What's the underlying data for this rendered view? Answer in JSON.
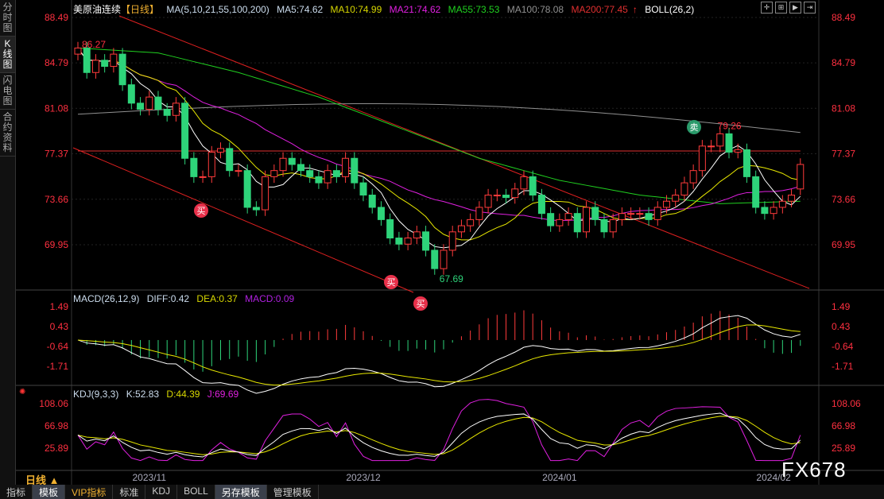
{
  "sidebar": [
    "分时图",
    "K线图",
    "闪电图",
    "合约资料"
  ],
  "header": {
    "title": "美原油连续",
    "period": "【日线】",
    "ma_label": "MA(5,10,21,55,100,200)",
    "ma5": "MA5:74.62",
    "ma10": "MA10:74.99",
    "ma21": "MA21:74.62",
    "ma55": "MA55:73.53",
    "ma100": "MA100:78.08",
    "ma200": "MA200:77.45",
    "boll": "BOLL(26,2)"
  },
  "colors": {
    "ma5": "#ffffff",
    "ma10": "#e8e800",
    "ma21": "#e020e0",
    "ma55": "#20d020",
    "ma100": "#909090",
    "ma200": "#e03030",
    "up": "#ff3b3b",
    "down": "#2ed47a",
    "axis": "#ff3040"
  },
  "macd": {
    "label": "MACD(26,12,9)",
    "diff": "DIFF:0.42",
    "dea": "DEA:0.37",
    "macd": "MACD:0.09",
    "ticks": [
      "1.49",
      "0.43",
      "-0.64",
      "-1.71"
    ]
  },
  "kdj": {
    "label": "KDJ(9,3,3)",
    "k": "K:52.83",
    "d": "D:44.39",
    "j": "J:69.69",
    "ticks": [
      "108.06",
      "66.98",
      "25.89"
    ]
  },
  "bottom_tabs": [
    "指标",
    "模板",
    "VIP指标",
    "标准",
    "KDJ",
    "BOLL",
    "另存模板",
    "管理模板"
  ],
  "period_button": "日线 ▲",
  "watermark": "FX678",
  "chart_data": {
    "type": "candlestick",
    "price_ticks": [
      "88.49",
      "84.79",
      "81.08",
      "77.37",
      "73.66",
      "69.95"
    ],
    "ylim": [
      67.5,
      88.49
    ],
    "x_labels": [
      {
        "label": "2023/11",
        "index": 8
      },
      {
        "label": "2023/12",
        "index": 32
      },
      {
        "label": "2024/01",
        "index": 54
      },
      {
        "label": "2024/02",
        "index": 78
      }
    ],
    "annotations": {
      "high": "86.27",
      "low": "67.69",
      "recent_high": "79.26",
      "buy": "买",
      "sell": "卖"
    },
    "close": [
      86,
      84,
      85,
      84.5,
      85.5,
      83,
      81.5,
      81,
      82,
      81,
      80.5,
      81.5,
      77,
      75.5,
      75.5,
      77.5,
      77.8,
      76,
      76,
      73,
      72.8,
      75.5,
      76,
      77,
      76.5,
      76,
      75.5,
      75,
      76,
      75.5,
      77,
      75,
      74,
      73,
      72,
      70.5,
      70,
      70.5,
      71,
      69.5,
      68,
      69.5,
      71,
      71.5,
      72,
      73,
      74,
      74,
      73.8,
      74.5,
      75.5,
      74,
      72.5,
      71.5,
      72,
      72.5,
      71,
      73,
      72,
      71,
      72,
      72.5,
      72.5,
      72.5,
      72,
      73,
      73.5,
      74,
      75,
      76,
      78,
      78,
      79,
      77.5,
      77.7,
      75.5,
      73,
      72.5,
      73,
      73.5,
      74,
      76.5
    ],
    "open": [
      85.5,
      86,
      84,
      85,
      84.5,
      85.5,
      83,
      81.5,
      81,
      82,
      81,
      80.5,
      81.5,
      77,
      75.5,
      75.5,
      77.5,
      77.8,
      76,
      76,
      73,
      72.8,
      75.5,
      76,
      77,
      76.5,
      76,
      75.5,
      75,
      76,
      75.5,
      77,
      75,
      74,
      73,
      72,
      70.5,
      70,
      70.5,
      71,
      69.5,
      68,
      69.5,
      71,
      71.5,
      72,
      73,
      74,
      74,
      73.8,
      74.5,
      75.5,
      74,
      72.5,
      71.5,
      72,
      72.5,
      71,
      73,
      72,
      71,
      72,
      72.5,
      72.5,
      72.5,
      72,
      73,
      73.5,
      74,
      75,
      76,
      78,
      78,
      79,
      77.5,
      77.7,
      75.5,
      73,
      72.5,
      73,
      73.5,
      74.5
    ]
  }
}
